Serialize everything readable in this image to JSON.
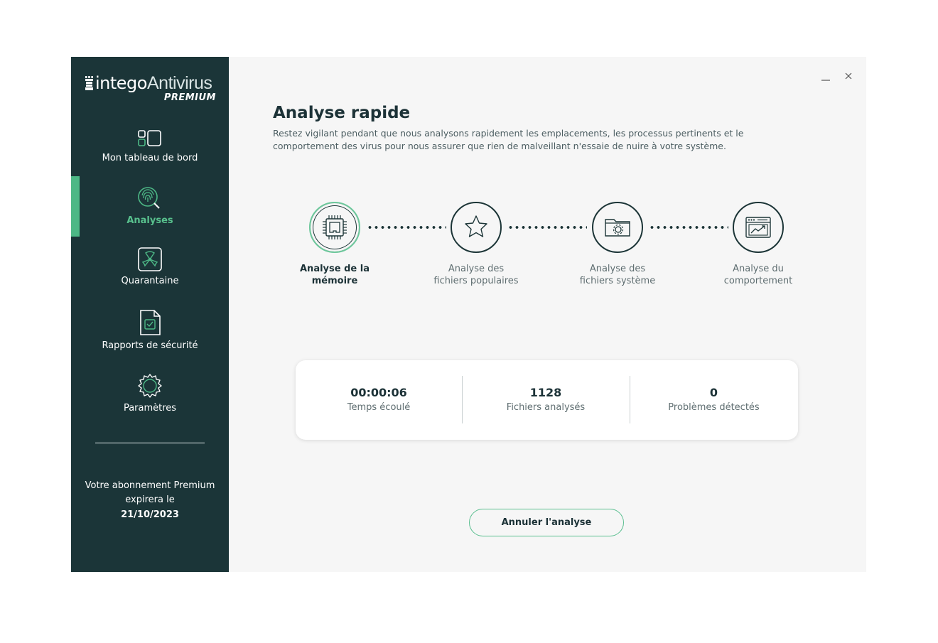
{
  "app": {
    "brand_word1": "intego",
    "brand_word2": "Antivirus",
    "edition": "PREMIUM"
  },
  "sidebar": {
    "items": [
      {
        "label": "Mon tableau de bord",
        "icon": "dashboard-icon",
        "active": false
      },
      {
        "label": "Analyses",
        "icon": "fingerprint-search-icon",
        "active": true
      },
      {
        "label": "Quarantaine",
        "icon": "radiation-icon",
        "active": false
      },
      {
        "label": "Rapports de sécurité",
        "icon": "report-icon",
        "active": false
      },
      {
        "label": "Paramètres",
        "icon": "gear-icon",
        "active": false
      }
    ],
    "subscription": {
      "text": "Votre abonnement Premium expirera le",
      "date": "21/10/2023"
    }
  },
  "main": {
    "title": "Analyse rapide",
    "description": "Restez vigilant pendant que nous analysons rapidement les emplacements, les processus pertinents et le comportement des virus pour nous assurer que rien de malveillant n'essaie de nuire à votre système.",
    "steps": [
      {
        "label": "Analyse de la\nmémoire",
        "icon": "memory-chip-icon",
        "state": "current"
      },
      {
        "label": "Analyse des\nfichiers populaires",
        "icon": "star-icon",
        "state": "pending"
      },
      {
        "label": "Analyse des\nfichiers système",
        "icon": "system-folder-icon",
        "state": "pending"
      },
      {
        "label": "Analyse du\ncomportement",
        "icon": "behavior-chart-icon",
        "state": "pending"
      }
    ],
    "stats": [
      {
        "value": "00:00:06",
        "label": "Temps écoulé"
      },
      {
        "value": "1128",
        "label": "Fichiers analysés"
      },
      {
        "value": "0",
        "label": "Problèmes détectés"
      }
    ],
    "cancel_label": "Annuler l'analyse"
  },
  "colors": {
    "sidebar_bg": "#1b3538",
    "accent_green": "#4db886",
    "main_bg": "#f6f6f6",
    "text_dark": "#1c3237"
  }
}
